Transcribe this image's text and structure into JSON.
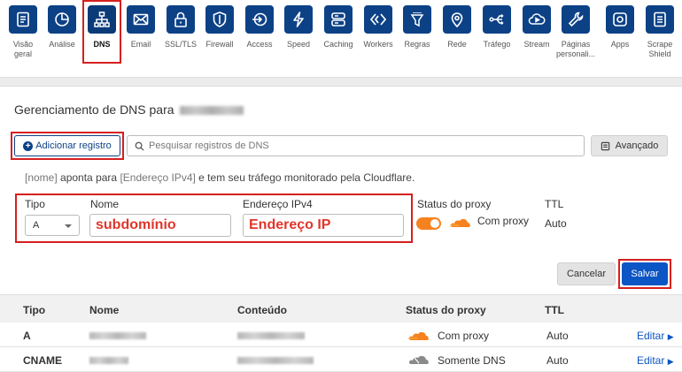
{
  "nav": {
    "items": [
      {
        "label": "Visão geral",
        "icon": "document-icon"
      },
      {
        "label": "Análise",
        "icon": "pie-chart-icon"
      },
      {
        "label": "DNS",
        "icon": "network-icon"
      },
      {
        "label": "Email",
        "icon": "envelope-icon"
      },
      {
        "label": "SSL/TLS",
        "icon": "lock-icon"
      },
      {
        "label": "Firewall",
        "icon": "shield-icon"
      },
      {
        "label": "Access",
        "icon": "access-arrow-icon"
      },
      {
        "label": "Speed",
        "icon": "lightning-icon"
      },
      {
        "label": "Caching",
        "icon": "server-stack-icon"
      },
      {
        "label": "Workers",
        "icon": "workers-diamond-icon"
      },
      {
        "label": "Regras",
        "icon": "funnel-icon"
      },
      {
        "label": "Rede",
        "icon": "location-pin-icon"
      },
      {
        "label": "Tráfego",
        "icon": "traffic-split-icon"
      },
      {
        "label": "Stream",
        "icon": "cloud-play-icon"
      },
      {
        "label": "Páginas personali...",
        "icon": "wrench-icon"
      },
      {
        "label": "Apps",
        "icon": "apps-icon"
      },
      {
        "label": "Scrape Shield",
        "icon": "scrape-document-icon"
      }
    ],
    "active": "DNS"
  },
  "panel": {
    "title": "Gerenciamento de DNS para",
    "add_button": "Adicionar registro",
    "search_placeholder": "Pesquisar registros de DNS",
    "advanced_button": "Avançado",
    "info": {
      "name_token": "[nome]",
      "text1": "aponta para",
      "addr_token": "[Endereço IPv4]",
      "text2": "e tem seu tráfego monitorado pela Cloudflare."
    },
    "form": {
      "type_label": "Tipo",
      "type_value": "A",
      "name_label": "Nome",
      "name_value": "subdomínio",
      "address_label": "Endereço IPv4",
      "address_value": "Endereço IP",
      "proxy_label": "Status do proxy",
      "proxy_value": "Com proxy",
      "proxy_on": true,
      "ttl_label": "TTL",
      "ttl_value": "Auto"
    },
    "cancel_button": "Cancelar",
    "save_button": "Salvar"
  },
  "table": {
    "headers": [
      "Tipo",
      "Nome",
      "Conteúdo",
      "Status do proxy",
      "TTL"
    ],
    "rows": [
      {
        "type": "A",
        "proxy": "Com proxy",
        "proxied": true,
        "ttl": "Auto",
        "action": "Editar"
      },
      {
        "type": "CNAME",
        "proxy": "Somente DNS",
        "proxied": false,
        "ttl": "Auto",
        "action": "Editar"
      }
    ]
  },
  "colors": {
    "nav_icon_bg": "#0c4186",
    "highlight": "#d61f1f",
    "proxy_orange": "#f6821f",
    "primary_button": "#0c55c4",
    "field_text_red": "#e0362b"
  }
}
